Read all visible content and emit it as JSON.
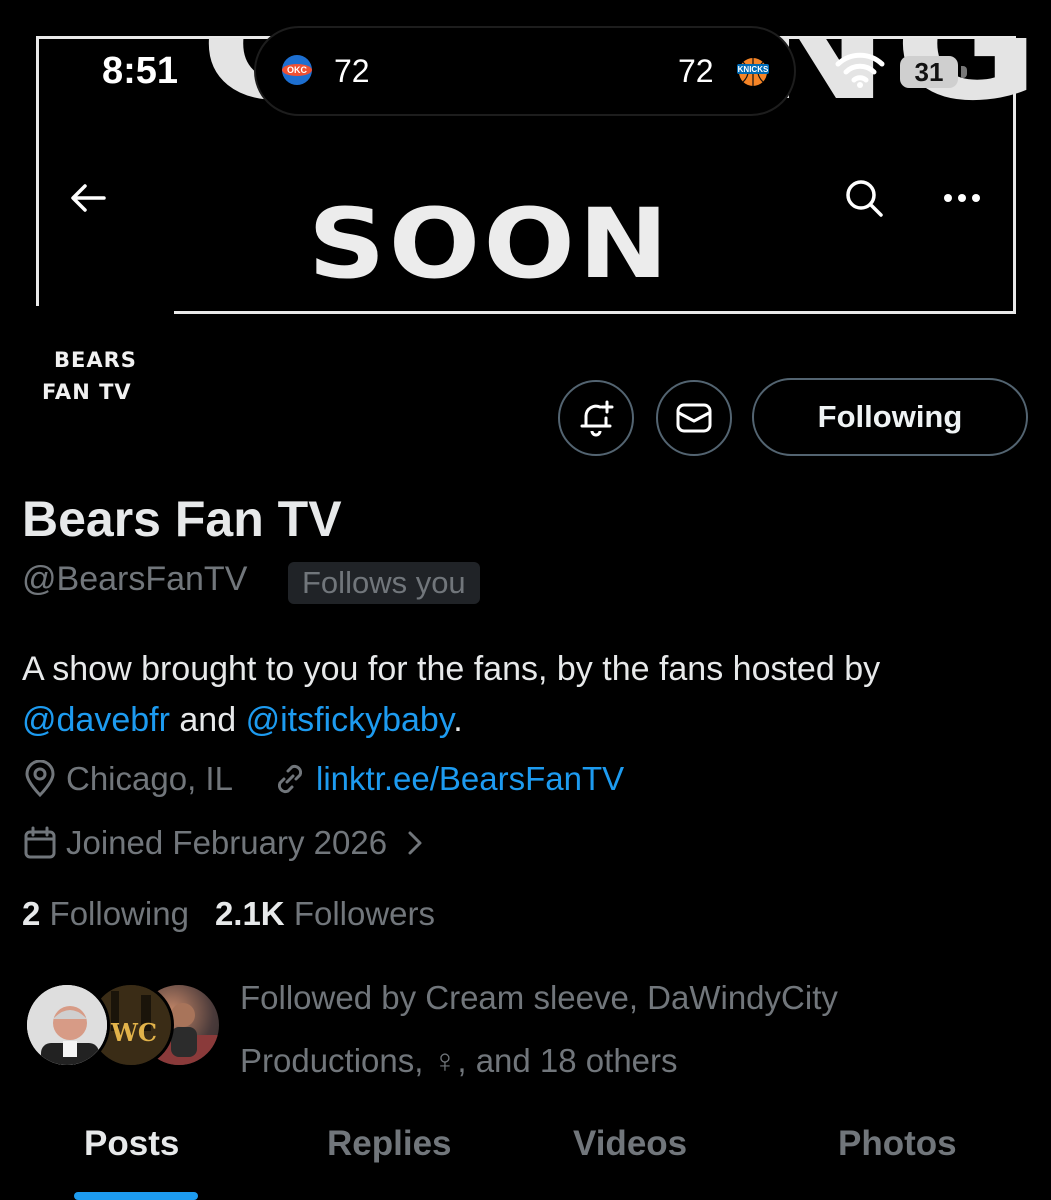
{
  "status_bar": {
    "time": "8:51",
    "live_activity": {
      "home_team_icon": "okc-thunder-logo",
      "home_score": "72",
      "away_team_icon": "knicks-logo",
      "away_score": "72"
    },
    "wifi_icon": "wifi-icon",
    "battery_level": "31"
  },
  "banner": {
    "line1": "COMING",
    "line2": "SOON"
  },
  "nav": {
    "back_icon": "arrow-left-icon",
    "search_icon": "search-icon",
    "more_icon": "more-horizontal-icon"
  },
  "avatar": {
    "line1": "BEARS",
    "line2": "FAN TV"
  },
  "actions": {
    "notify_icon": "bell-plus-icon",
    "message_icon": "envelope-icon",
    "follow_label": "Following"
  },
  "profile": {
    "display_name": "Bears Fan TV",
    "handle": "@BearsFanTV",
    "follows_you": "Follows you",
    "bio_prefix": "A show brought to you for the fans, by the fans hosted by",
    "bio_mention1": "@davebfr",
    "bio_and": "and",
    "bio_mention2": "@itsfickybaby",
    "bio_suffix": ".",
    "location": "Chicago, IL",
    "url": "linktr.ee/BearsFanTV",
    "joined": "Joined February 2026"
  },
  "counts": {
    "following_count": "2",
    "following_label": "Following",
    "followers_count": "2.1K",
    "followers_label": "Followers"
  },
  "followed_by": {
    "text_line1": "Followed by Cream sleeve, DaWindyCity",
    "text_line2": "Productions, ♀, and 18 others"
  },
  "tabs": [
    {
      "label": "Posts",
      "active": true
    },
    {
      "label": "Replies",
      "active": false
    },
    {
      "label": "Videos",
      "active": false
    },
    {
      "label": "Photos",
      "active": false
    }
  ],
  "colors": {
    "accent": "#1d9bf0",
    "secondary_text": "#71767b",
    "primary_text": "#e7e9ea",
    "background": "#000000"
  }
}
